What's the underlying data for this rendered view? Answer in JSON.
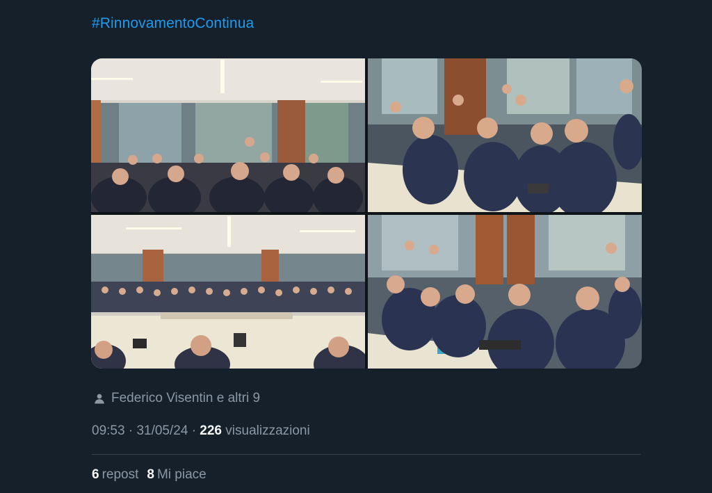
{
  "post": {
    "hashtag": "#RinnovamentoContinua",
    "tagged_people": "Federico Visentin e altri 9",
    "time": "09:53",
    "date": "31/05/24",
    "separator": "·",
    "views_count": "226",
    "views_label": "visualizzazioni",
    "reposts_count": "6",
    "reposts_label": "repost",
    "likes_count": "8",
    "likes_label": "Mi piace"
  },
  "icons": {
    "tagged": "person-icon"
  },
  "colors": {
    "background": "#15202b",
    "link": "#1d9bf0",
    "secondary_text": "#8b98a5",
    "primary_text": "#f7f9f9",
    "divider": "#38444d"
  }
}
